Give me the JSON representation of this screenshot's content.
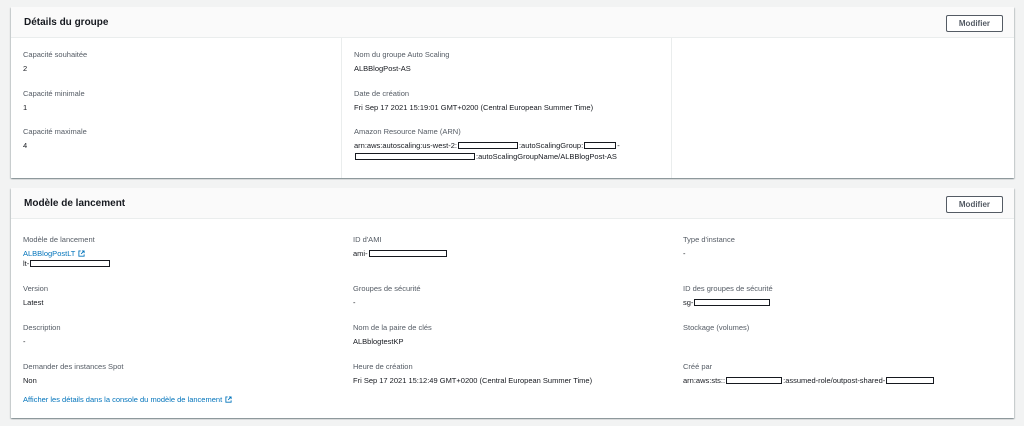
{
  "group_details": {
    "title": "Détails du groupe",
    "edit_label": "Modifier",
    "desired_capacity": {
      "label": "Capacité souhaitée",
      "value": "2"
    },
    "min_capacity": {
      "label": "Capacité minimale",
      "value": "1"
    },
    "max_capacity": {
      "label": "Capacité maximale",
      "value": "4"
    },
    "asg_name": {
      "label": "Nom du groupe Auto Scaling",
      "value": "ALBBlogPost-AS"
    },
    "created": {
      "label": "Date de création",
      "value": "Fri Sep 17 2021 15:19:01 GMT+0200 (Central European Summer Time)"
    },
    "arn": {
      "label": "Amazon Resource Name (ARN)",
      "line1_a": "arn:aws:autoscaling:us-west-2:",
      "line1_b": ":autoScalingGroup:",
      "line1_c": "-",
      "line2_b": ":autoScalingGroupName/ALBBlogPost-AS"
    }
  },
  "launch_template": {
    "title": "Modèle de lancement",
    "edit_label": "Modifier",
    "template": {
      "label": "Modèle de lancement",
      "link": "ALBBlogPostLT",
      "id_prefix": "lt-"
    },
    "version": {
      "label": "Version",
      "value": "Latest"
    },
    "description": {
      "label": "Description",
      "value": "-"
    },
    "spot": {
      "label": "Demander des instances Spot",
      "value": "Non"
    },
    "ami": {
      "label": "ID d'AMI",
      "prefix": "ami-"
    },
    "security_groups": {
      "label": "Groupes de sécurité",
      "value": "-"
    },
    "key_pair": {
      "label": "Nom de la paire de clés",
      "value": "ALBblogtestKP"
    },
    "created_time": {
      "label": "Heure de création",
      "value": "Fri Sep 17 2021 15:12:49 GMT+0200 (Central European Summer Time)"
    },
    "instance_type": {
      "label": "Type d'instance",
      "value": "-"
    },
    "sg_ids": {
      "label": "ID des groupes de sécurité",
      "prefix": "sg-"
    },
    "storage": {
      "label": "Stockage (volumes)"
    },
    "created_by": {
      "label": "Créé par",
      "part_a": "arn:aws:sts::",
      "part_b": ":assumed-role/outpost-shared-"
    },
    "console_link": "Afficher les détails dans la console du modèle de lancement"
  },
  "colors": {
    "link": "#0073bb",
    "border": "#eaeded",
    "text": "#16191f",
    "label": "#545b64"
  }
}
